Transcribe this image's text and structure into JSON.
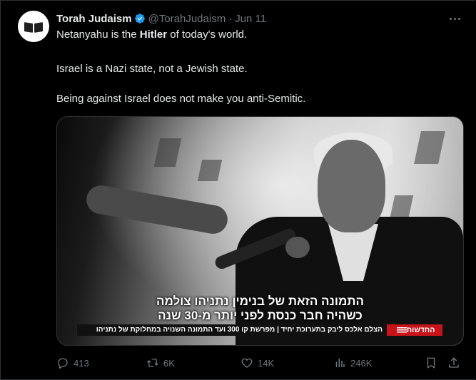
{
  "author": {
    "name": "Torah Judaism",
    "handle": "@TorahJudaism",
    "separator": "·",
    "date": "Jun 11",
    "avatar_icon": "open-book-icon",
    "verified_color": "#1d9bf0"
  },
  "tweet": {
    "line1_before": "Netanyahu is the ",
    "line1_bold": "Hitler",
    "line1_after": " of today's world.",
    "line2": "Israel is a Nazi state, not a Jewish state.",
    "line3": "Being against Israel does not make you anti-Semitic."
  },
  "media": {
    "subtitle_line1": "התמונה הזאת של בנימין נתניהו צולמה",
    "subtitle_line2": "כשהיה חבר כנסת לפני יותר מ-30 שנה",
    "ticker_text": "הצלם אלכס ליבק בתערוכת יחיד | מפרשת קו 300 ועד התמונה השנויה במחלוקת של נתניהו",
    "channel_label": "החדשות"
  },
  "actions": {
    "replies": "413",
    "reposts": "6K",
    "likes": "14K",
    "views": "246K"
  },
  "colors": {
    "background": "#000000",
    "text": "#e7e9ea",
    "muted": "#71767b",
    "channel_red": "#c7141a"
  }
}
